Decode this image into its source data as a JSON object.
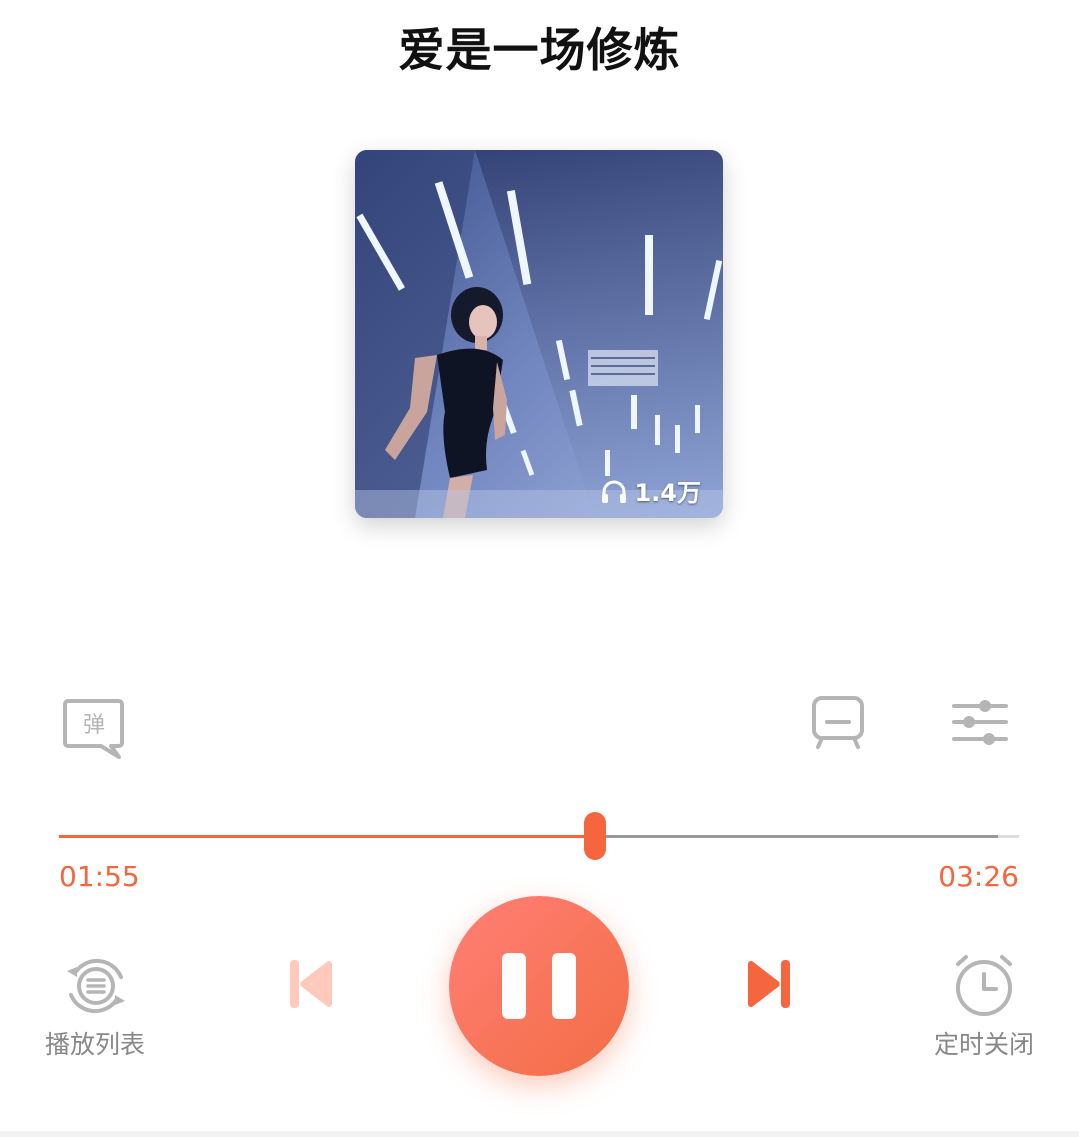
{
  "song": {
    "title": "爱是一场修炼"
  },
  "cover": {
    "play_count": "1.4万",
    "play_count_icon": "headphones-icon"
  },
  "tools": {
    "danmaku_icon": "danmaku-icon",
    "danmaku_char": "弹",
    "lyrics_icon": "tv-lyrics-icon",
    "equalizer_icon": "equalizer-icon"
  },
  "progress": {
    "current": "01:55",
    "total": "03:26",
    "played_fraction": 0.558,
    "buffered_fraction": 0.978
  },
  "controls": {
    "playlist_label": "播放列表",
    "playlist_icon": "playlist-icon",
    "prev_icon": "previous-icon",
    "pause_icon": "pause-icon",
    "next_icon": "next-icon",
    "timer_label": "定时关闭",
    "timer_icon": "alarm-clock-icon"
  },
  "colors": {
    "accent": "#f5663f",
    "accent_light": "#ffcabb",
    "muted": "#b5b5b5"
  }
}
